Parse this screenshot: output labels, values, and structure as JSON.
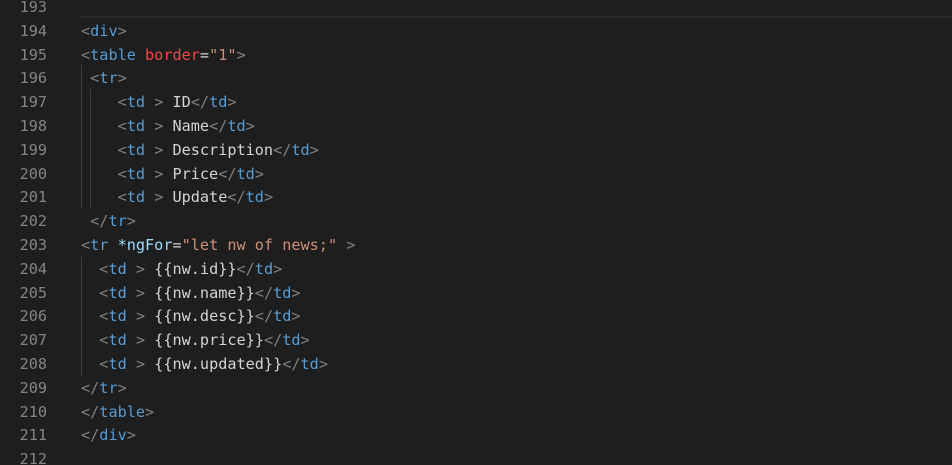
{
  "editor": {
    "colors": {
      "background": "#1e1e1e",
      "line_number": "#858585",
      "bracket": "#808080",
      "tag": "#569cd6",
      "attribute": "#9cdcfe",
      "attribute_error": "#f44747",
      "string": "#ce9178",
      "text": "#d4d4d4"
    },
    "lines": [
      {
        "number": "193",
        "tokens": []
      },
      {
        "number": "194",
        "tokens": [
          {
            "t": "bracket",
            "v": "<"
          },
          {
            "t": "tag",
            "v": "div"
          },
          {
            "t": "bracket",
            "v": ">"
          }
        ]
      },
      {
        "number": "195",
        "tokens": [
          {
            "t": "bracket",
            "v": "<"
          },
          {
            "t": "tag",
            "v": "table"
          },
          {
            "t": "text",
            "v": " "
          },
          {
            "t": "attr-red",
            "v": "border"
          },
          {
            "t": "text",
            "v": "="
          },
          {
            "t": "string",
            "v": "\"1\""
          },
          {
            "t": "bracket",
            "v": ">"
          }
        ]
      },
      {
        "number": "196",
        "tokens": [
          {
            "t": "text",
            "v": " "
          },
          {
            "t": "bracket",
            "v": "<"
          },
          {
            "t": "tag",
            "v": "tr"
          },
          {
            "t": "bracket",
            "v": ">"
          }
        ]
      },
      {
        "number": "197",
        "tokens": [
          {
            "t": "text",
            "v": "    "
          },
          {
            "t": "bracket",
            "v": "<"
          },
          {
            "t": "tag",
            "v": "td"
          },
          {
            "t": "text",
            "v": " "
          },
          {
            "t": "bracket",
            "v": ">"
          },
          {
            "t": "text",
            "v": " ID"
          },
          {
            "t": "bracket",
            "v": "</"
          },
          {
            "t": "tag",
            "v": "td"
          },
          {
            "t": "bracket",
            "v": ">"
          }
        ]
      },
      {
        "number": "198",
        "tokens": [
          {
            "t": "text",
            "v": "    "
          },
          {
            "t": "bracket",
            "v": "<"
          },
          {
            "t": "tag",
            "v": "td"
          },
          {
            "t": "text",
            "v": " "
          },
          {
            "t": "bracket",
            "v": ">"
          },
          {
            "t": "text",
            "v": " Name"
          },
          {
            "t": "bracket",
            "v": "</"
          },
          {
            "t": "tag",
            "v": "td"
          },
          {
            "t": "bracket",
            "v": ">"
          }
        ]
      },
      {
        "number": "199",
        "tokens": [
          {
            "t": "text",
            "v": "    "
          },
          {
            "t": "bracket",
            "v": "<"
          },
          {
            "t": "tag",
            "v": "td"
          },
          {
            "t": "text",
            "v": " "
          },
          {
            "t": "bracket",
            "v": ">"
          },
          {
            "t": "text",
            "v": " Description"
          },
          {
            "t": "bracket",
            "v": "</"
          },
          {
            "t": "tag",
            "v": "td"
          },
          {
            "t": "bracket",
            "v": ">"
          }
        ]
      },
      {
        "number": "200",
        "tokens": [
          {
            "t": "text",
            "v": "    "
          },
          {
            "t": "bracket",
            "v": "<"
          },
          {
            "t": "tag",
            "v": "td"
          },
          {
            "t": "text",
            "v": " "
          },
          {
            "t": "bracket",
            "v": ">"
          },
          {
            "t": "text",
            "v": " Price"
          },
          {
            "t": "bracket",
            "v": "</"
          },
          {
            "t": "tag",
            "v": "td"
          },
          {
            "t": "bracket",
            "v": ">"
          }
        ]
      },
      {
        "number": "201",
        "tokens": [
          {
            "t": "text",
            "v": "    "
          },
          {
            "t": "bracket",
            "v": "<"
          },
          {
            "t": "tag",
            "v": "td"
          },
          {
            "t": "text",
            "v": " "
          },
          {
            "t": "bracket",
            "v": ">"
          },
          {
            "t": "text",
            "v": " Update"
          },
          {
            "t": "bracket",
            "v": "</"
          },
          {
            "t": "tag",
            "v": "td"
          },
          {
            "t": "bracket",
            "v": ">"
          }
        ]
      },
      {
        "number": "202",
        "tokens": [
          {
            "t": "text",
            "v": " "
          },
          {
            "t": "bracket",
            "v": "</"
          },
          {
            "t": "tag",
            "v": "tr"
          },
          {
            "t": "bracket",
            "v": ">"
          }
        ]
      },
      {
        "number": "203",
        "tokens": [
          {
            "t": "bracket",
            "v": "<"
          },
          {
            "t": "tag",
            "v": "tr"
          },
          {
            "t": "text",
            "v": " "
          },
          {
            "t": "attr",
            "v": "*ngFor"
          },
          {
            "t": "text",
            "v": "="
          },
          {
            "t": "string",
            "v": "\"let nw of news;\""
          },
          {
            "t": "text",
            "v": " "
          },
          {
            "t": "bracket",
            "v": ">"
          }
        ]
      },
      {
        "number": "204",
        "tokens": [
          {
            "t": "text",
            "v": "  "
          },
          {
            "t": "bracket",
            "v": "<"
          },
          {
            "t": "tag",
            "v": "td"
          },
          {
            "t": "text",
            "v": " "
          },
          {
            "t": "bracket",
            "v": ">"
          },
          {
            "t": "text",
            "v": " {{nw.id}}"
          },
          {
            "t": "bracket",
            "v": "</"
          },
          {
            "t": "tag",
            "v": "td"
          },
          {
            "t": "bracket",
            "v": ">"
          }
        ]
      },
      {
        "number": "205",
        "tokens": [
          {
            "t": "text",
            "v": "  "
          },
          {
            "t": "bracket",
            "v": "<"
          },
          {
            "t": "tag",
            "v": "td"
          },
          {
            "t": "text",
            "v": " "
          },
          {
            "t": "bracket",
            "v": ">"
          },
          {
            "t": "text",
            "v": " {{nw.name}}"
          },
          {
            "t": "bracket",
            "v": "</"
          },
          {
            "t": "tag",
            "v": "td"
          },
          {
            "t": "bracket",
            "v": ">"
          }
        ]
      },
      {
        "number": "206",
        "tokens": [
          {
            "t": "text",
            "v": "  "
          },
          {
            "t": "bracket",
            "v": "<"
          },
          {
            "t": "tag",
            "v": "td"
          },
          {
            "t": "text",
            "v": " "
          },
          {
            "t": "bracket",
            "v": ">"
          },
          {
            "t": "text",
            "v": " {{nw.desc}}"
          },
          {
            "t": "bracket",
            "v": "</"
          },
          {
            "t": "tag",
            "v": "td"
          },
          {
            "t": "bracket",
            "v": ">"
          }
        ]
      },
      {
        "number": "207",
        "tokens": [
          {
            "t": "text",
            "v": "  "
          },
          {
            "t": "bracket",
            "v": "<"
          },
          {
            "t": "tag",
            "v": "td"
          },
          {
            "t": "text",
            "v": " "
          },
          {
            "t": "bracket",
            "v": ">"
          },
          {
            "t": "text",
            "v": " {{nw.price}}"
          },
          {
            "t": "bracket",
            "v": "</"
          },
          {
            "t": "tag",
            "v": "td"
          },
          {
            "t": "bracket",
            "v": ">"
          }
        ]
      },
      {
        "number": "208",
        "tokens": [
          {
            "t": "text",
            "v": "  "
          },
          {
            "t": "bracket",
            "v": "<"
          },
          {
            "t": "tag",
            "v": "td"
          },
          {
            "t": "text",
            "v": " "
          },
          {
            "t": "bracket",
            "v": ">"
          },
          {
            "t": "text",
            "v": " {{nw.updated}}"
          },
          {
            "t": "bracket",
            "v": "</"
          },
          {
            "t": "tag",
            "v": "td"
          },
          {
            "t": "bracket",
            "v": ">"
          }
        ]
      },
      {
        "number": "209",
        "tokens": [
          {
            "t": "bracket",
            "v": "</"
          },
          {
            "t": "tag",
            "v": "tr"
          },
          {
            "t": "bracket",
            "v": ">"
          }
        ]
      },
      {
        "number": "210",
        "tokens": [
          {
            "t": "bracket",
            "v": "</"
          },
          {
            "t": "tag",
            "v": "table"
          },
          {
            "t": "bracket",
            "v": ">"
          }
        ]
      },
      {
        "number": "211",
        "tokens": [
          {
            "t": "bracket",
            "v": "</"
          },
          {
            "t": "tag",
            "v": "div"
          },
          {
            "t": "bracket",
            "v": ">"
          }
        ]
      },
      {
        "number": "212",
        "tokens": []
      }
    ]
  }
}
